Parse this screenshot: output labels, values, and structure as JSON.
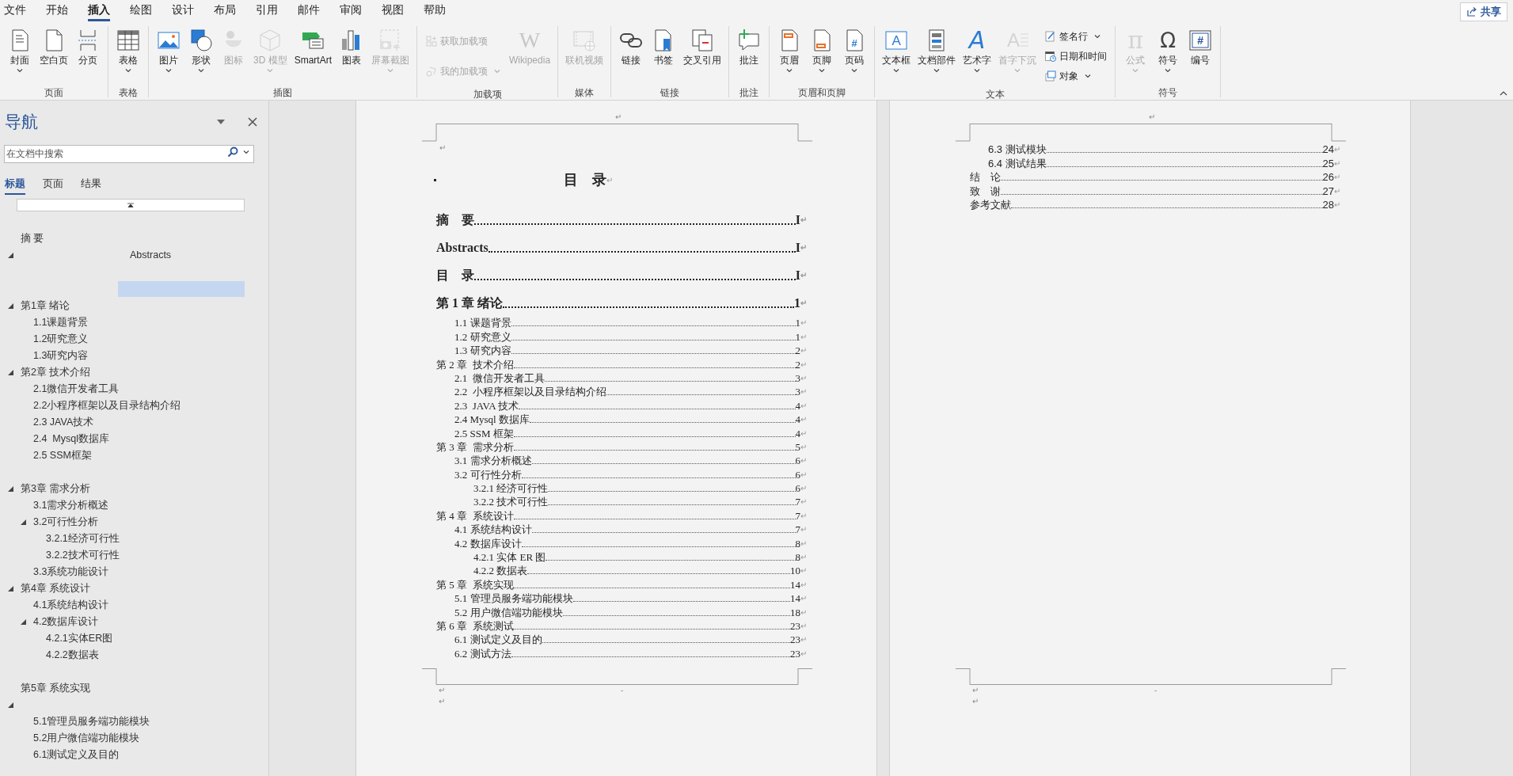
{
  "menu_tabs": [
    {
      "label": "文件",
      "selected": false
    },
    {
      "label": "开始",
      "selected": false
    },
    {
      "label": "插入",
      "selected": true
    },
    {
      "label": "绘图",
      "selected": false
    },
    {
      "label": "设计",
      "selected": false
    },
    {
      "label": "布局",
      "selected": false
    },
    {
      "label": "引用",
      "selected": false
    },
    {
      "label": "邮件",
      "selected": false
    },
    {
      "label": "审阅",
      "selected": false
    },
    {
      "label": "视图",
      "selected": false
    },
    {
      "label": "帮助",
      "selected": false
    }
  ],
  "share_button": {
    "label": "共享"
  },
  "ribbon_groups": [
    {
      "label": "页面",
      "buttons": [
        {
          "label": "封面",
          "kind": "large",
          "dropdown": true,
          "disabled": false
        },
        {
          "label": "空白页",
          "kind": "large",
          "dropdown": false,
          "disabled": false
        },
        {
          "label": "分页",
          "kind": "large",
          "dropdown": false,
          "disabled": false
        }
      ]
    },
    {
      "label": "表格",
      "buttons": [
        {
          "label": "表格",
          "kind": "large",
          "dropdown": true,
          "disabled": false
        }
      ]
    },
    {
      "label": "插图",
      "buttons": [
        {
          "label": "图片",
          "kind": "large",
          "dropdown": true,
          "disabled": false
        },
        {
          "label": "形状",
          "kind": "large",
          "dropdown": true,
          "disabled": false
        },
        {
          "label": "图标",
          "kind": "large",
          "dropdown": false,
          "disabled": true
        },
        {
          "label": "3D 模型",
          "kind": "large",
          "dropdown": true,
          "disabled": true
        },
        {
          "label": "SmartArt",
          "kind": "large",
          "dropdown": false,
          "disabled": false
        },
        {
          "label": "图表",
          "kind": "large",
          "dropdown": false,
          "disabled": false
        },
        {
          "label": "屏幕截图",
          "kind": "large",
          "dropdown": true,
          "disabled": true
        }
      ]
    },
    {
      "label": "加载项",
      "buttons": [
        {
          "label": "获取加载项",
          "kind": "small",
          "dropdown": false,
          "disabled": true
        },
        {
          "label": "我的加载项",
          "kind": "small",
          "dropdown": true,
          "disabled": true
        },
        {
          "label": "Wikipedia",
          "kind": "large",
          "dropdown": false,
          "disabled": true,
          "glyph": "W"
        }
      ]
    },
    {
      "label": "媒体",
      "buttons": [
        {
          "label": "联机视频",
          "kind": "large",
          "dropdown": false,
          "disabled": true
        }
      ]
    },
    {
      "label": "链接",
      "buttons": [
        {
          "label": "链接",
          "kind": "large",
          "dropdown": false,
          "disabled": false
        },
        {
          "label": "书签",
          "kind": "large",
          "dropdown": false,
          "disabled": false
        },
        {
          "label": "交叉引用",
          "kind": "large",
          "dropdown": false,
          "disabled": false
        }
      ]
    },
    {
      "label": "批注",
      "buttons": [
        {
          "label": "批注",
          "kind": "large",
          "dropdown": false,
          "disabled": false
        }
      ]
    },
    {
      "label": "页眉和页脚",
      "buttons": [
        {
          "label": "页眉",
          "kind": "large",
          "dropdown": true,
          "disabled": false
        },
        {
          "label": "页脚",
          "kind": "large",
          "dropdown": true,
          "disabled": false
        },
        {
          "label": "页码",
          "kind": "large",
          "dropdown": true,
          "disabled": false,
          "glyph": "#"
        }
      ]
    },
    {
      "label": "文本",
      "buttons": [
        {
          "label": "文本框",
          "kind": "large",
          "dropdown": true,
          "disabled": false,
          "glyph": "A"
        },
        {
          "label": "文档部件",
          "kind": "large",
          "dropdown": true,
          "disabled": false
        },
        {
          "label": "艺术字",
          "kind": "large",
          "dropdown": true,
          "disabled": false,
          "glyph": "A"
        },
        {
          "label": "首字下沉",
          "kind": "large",
          "dropdown": true,
          "disabled": true,
          "glyph": "A"
        },
        {
          "label": "签名行",
          "kind": "small",
          "dropdown": true,
          "disabled": false
        },
        {
          "label": "日期和时间",
          "kind": "small",
          "dropdown": false,
          "disabled": false
        },
        {
          "label": "对象",
          "kind": "small",
          "dropdown": true,
          "disabled": false
        }
      ]
    },
    {
      "label": "符号",
      "buttons": [
        {
          "label": "公式",
          "kind": "large",
          "dropdown": true,
          "disabled": true,
          "glyph": "π"
        },
        {
          "label": "符号",
          "kind": "large",
          "dropdown": true,
          "disabled": false,
          "glyph": "Ω"
        },
        {
          "label": "编号",
          "kind": "large",
          "dropdown": false,
          "disabled": false,
          "glyph": "#"
        }
      ]
    }
  ],
  "nav_pane": {
    "title": "导航",
    "search": {
      "placeholder": "在文档中搜索"
    },
    "tabs": [
      {
        "label": "标题",
        "selected": true
      },
      {
        "label": "页面",
        "selected": false
      },
      {
        "label": "结果",
        "selected": false
      }
    ],
    "tree": [
      {
        "label": "摘 要"
      },
      {
        "label": "Abstracts",
        "expanded": true,
        "kind": "centered",
        "children": [
          {
            "kind": "highlight"
          }
        ]
      },
      {
        "label": "第1章 绪论",
        "expanded": true,
        "children": [
          {
            "label": "1.1课题背景"
          },
          {
            "label": "1.2研究意义"
          },
          {
            "label": "1.3研究内容"
          }
        ]
      },
      {
        "label": "第2章 技术介绍",
        "expanded": true,
        "children": [
          {
            "label": "2.1微信开发者工具"
          },
          {
            "label": "2.2小程序框架以及目录结构介绍"
          },
          {
            "label": "2.3 JAVA技术"
          },
          {
            "label": "2.4  Mysql数据库"
          },
          {
            "label": "2.5 SSM框架"
          }
        ]
      },
      {
        "label": "第3章 需求分析",
        "expanded": true,
        "space_before": true,
        "children": [
          {
            "label": "3.1需求分析概述"
          },
          {
            "label": "3.2可行性分析",
            "expanded": true,
            "children": [
              {
                "label": "3.2.1经济可行性"
              },
              {
                "label": "3.2.2技术可行性"
              }
            ]
          },
          {
            "label": "3.3系统功能设计"
          }
        ]
      },
      {
        "label": "第4章 系统设计",
        "expanded": true,
        "children": [
          {
            "label": "4.1系统结构设计"
          },
          {
            "label": "4.2数据库设计",
            "expanded": true,
            "children": [
              {
                "label": "4.2.1实体ER图"
              },
              {
                "label": "4.2.2数据表"
              }
            ]
          }
        ]
      },
      {
        "label": "第5章 系统实现",
        "space_before": true
      },
      {
        "expanded": true,
        "children": [
          {
            "label": "5.1管理员服务端功能模块"
          },
          {
            "label": "5.2用户微信端功能模块"
          },
          {
            "label": "6.1测试定义及目的"
          }
        ]
      }
    ]
  },
  "document": {
    "pages": [
      {
        "header_mark": "↵",
        "top_mark": "↵",
        "footer_dash": "-",
        "footer_marks": [
          "↵",
          "↵"
        ],
        "entries": [
          {
            "kind": "title",
            "label": "目　录",
            "end_mark": "↵"
          },
          {
            "kind": "major",
            "label": "摘　要",
            "page": "I",
            "end_mark": "↵"
          },
          {
            "kind": "major",
            "label": "Abstracts",
            "page": "I",
            "end_mark": "↵"
          },
          {
            "kind": "major",
            "label": "目　录",
            "page": "I",
            "end_mark": "↵"
          },
          {
            "kind": "major",
            "label": "第 1 章 绪论",
            "page": "1",
            "end_mark": "↵"
          },
          {
            "kind": "section",
            "label": "1.1 课题背景",
            "page": "1",
            "end_mark": "↵"
          },
          {
            "kind": "section",
            "label": "1.2 研究意义",
            "page": "1",
            "end_mark": "↵"
          },
          {
            "kind": "section",
            "label": "1.3 研究内容",
            "page": "2",
            "end_mark": "↵"
          },
          {
            "kind": "chapter",
            "label": "第 2 章  技术介绍",
            "page": "2",
            "end_mark": "↵"
          },
          {
            "kind": "section",
            "label": "2.1  微信开发者工具",
            "page": "3",
            "end_mark": "↵"
          },
          {
            "kind": "section",
            "label": "2.2  小程序框架以及目录结构介绍",
            "page": "3",
            "end_mark": "↵"
          },
          {
            "kind": "section",
            "label": "2.3  JAVA 技术",
            "page": "4",
            "end_mark": "↵"
          },
          {
            "kind": "section",
            "label": "2.4 Mysql 数据库",
            "page": "4",
            "end_mark": "↵"
          },
          {
            "kind": "section",
            "label": "2.5 SSM 框架",
            "page": "4",
            "end_mark": "↵"
          },
          {
            "kind": "chapter",
            "label": "第 3 章  需求分析",
            "page": "5",
            "end_mark": "↵"
          },
          {
            "kind": "section",
            "label": "3.1 需求分析概述",
            "page": "6",
            "end_mark": "↵"
          },
          {
            "kind": "section",
            "label": "3.2 可行性分析",
            "page": "6",
            "end_mark": "↵"
          },
          {
            "kind": "subsection",
            "label": "3.2.1 经济可行性",
            "page": "6",
            "end_mark": "↵"
          },
          {
            "kind": "subsection",
            "label": "3.2.2 技术可行性",
            "page": "7",
            "end_mark": "↵"
          },
          {
            "kind": "chapter",
            "label": "第 4 章  系统设计",
            "page": "7",
            "end_mark": "↵"
          },
          {
            "kind": "section",
            "label": "4.1 系统结构设计",
            "page": "7",
            "end_mark": "↵"
          },
          {
            "kind": "section",
            "label": "4.2 数据库设计",
            "page": "8",
            "end_mark": "↵"
          },
          {
            "kind": "subsection",
            "label": "4.2.1 实体 ER 图",
            "page": "8",
            "end_mark": "↵"
          },
          {
            "kind": "subsection",
            "label": "4.2.2 数据表",
            "page": "10",
            "end_mark": "↵"
          },
          {
            "kind": "chapter",
            "label": "第 5 章  系统实现",
            "page": "14",
            "end_mark": "↵"
          },
          {
            "kind": "section",
            "label": "5.1 管理员服务端功能模块",
            "page": "14",
            "end_mark": "↵"
          },
          {
            "kind": "section",
            "label": "5.2 用户微信端功能模块",
            "page": "18",
            "end_mark": "↵"
          },
          {
            "kind": "chapter",
            "label": "第 6 章  系统测试",
            "page": "23",
            "end_mark": "↵"
          },
          {
            "kind": "section",
            "label": "6.1 测试定义及目的",
            "page": "23",
            "end_mark": "↵"
          },
          {
            "kind": "section",
            "label": "6.2 测试方法",
            "page": "23",
            "end_mark": "↵"
          }
        ]
      },
      {
        "header_mark": "↵",
        "footer_dash": "-",
        "footer_marks": [
          "↵",
          "↵"
        ],
        "entries": [
          {
            "kind": "section",
            "label": "6.3 测试模块",
            "page": "24",
            "end_mark": "↵"
          },
          {
            "kind": "section",
            "label": "6.4 测试结果",
            "page": "25",
            "end_mark": "↵"
          },
          {
            "kind": "chapter",
            "label": "结　论",
            "page": "26",
            "end_mark": "↵"
          },
          {
            "kind": "chapter",
            "label": "致　谢",
            "page": "27",
            "end_mark": "↵"
          },
          {
            "kind": "chapter",
            "label": "参考文献",
            "page": "28",
            "end_mark": "↵"
          }
        ]
      }
    ]
  }
}
